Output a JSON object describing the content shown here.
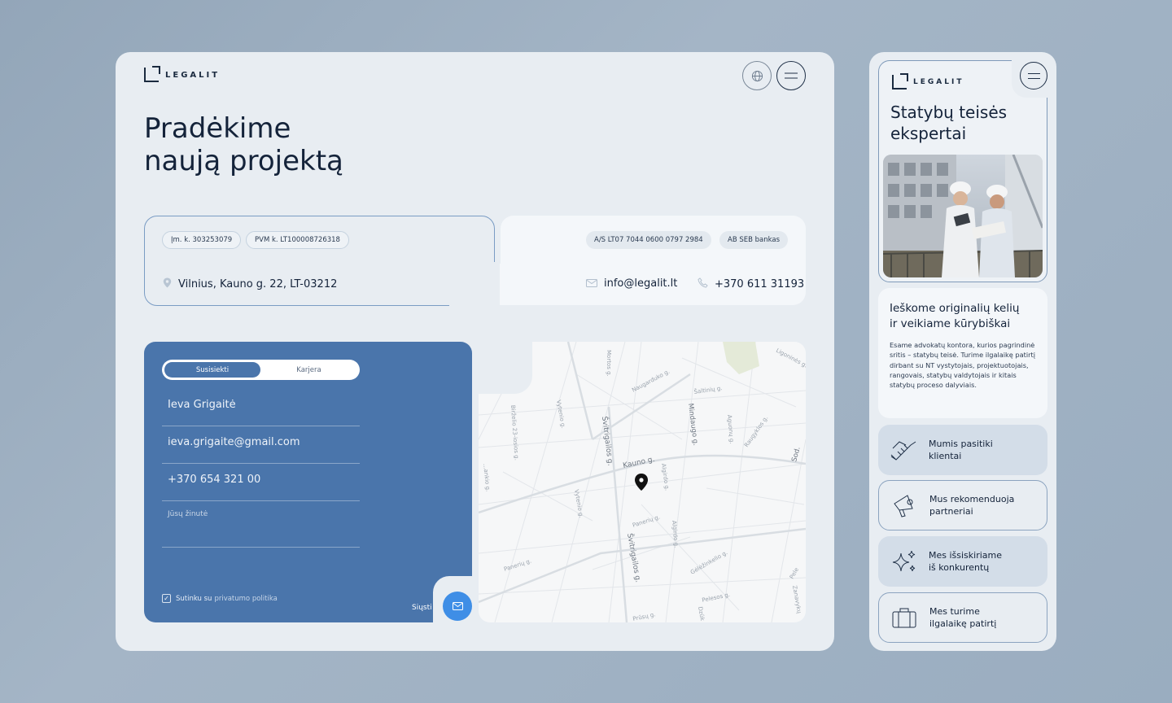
{
  "brand": {
    "name": "LEGALIT"
  },
  "desktop": {
    "heading_line1": "Pradėkime",
    "heading_line2": "naują projektą",
    "company": {
      "code": "Įm. k. 303253079",
      "vat": "PVM k. LT100008726318",
      "address": "Vilnius, Kauno g. 22, LT-03212",
      "account": "A/S LT07 7044 0600 0797 2984",
      "bank": "AB SEB bankas",
      "email": "info@legalit.lt",
      "phone": "+370 611 31193"
    },
    "form": {
      "tabs": [
        "Susisiekti",
        "Karjera"
      ],
      "name": "Ieva Grigaitė",
      "email": "ieva.grigaite@gmail.com",
      "phone": "+370 654 321 00",
      "message_placeholder": "Jūsų žinutė",
      "consent_prefix": "Sutinku su",
      "consent_link": "privatumo politika",
      "send_label": "Siųsti"
    },
    "map": {
      "streets": [
        "Mortos g.",
        "Naugarduko g.",
        "Šaltinių g.",
        "Ligoninės g.",
        "Birželio 23-iosios g.",
        "Vytenio g.",
        "Švitrigailos g.",
        "Mindaugo g.",
        "Algirdo g.",
        "Kauno g.",
        "Aguonų g.",
        "Raugyklos g.",
        "Sod.",
        "Vytenio g.",
        "Panerių g.",
        "Švitrigailos g.",
        "Algirdo g.",
        "Gėlėžinkelio g.",
        "Panerių g.",
        "Pelesos g.",
        "Pele",
        "Prūsų g.",
        "Dzūk",
        "Zanavykų",
        "...ankio g."
      ]
    }
  },
  "mobile": {
    "title_line1": "Statybų teisės",
    "title_line2": "ekspertai",
    "about_title_line1": "Ieškome originalių kelių",
    "about_title_line2": "ir veikiame kūrybiškai",
    "about_text": "Esame advokatų kontora, kurios pagrindinė sritis – statybų teisė. Turime ilgalaikę patirtį dirbant su NT vystytojais, projektuotojais, rangovais, statybų valdytojais ir kitais statybų proceso dalyviais.",
    "features": [
      {
        "line1": "Mumis pasitiki",
        "line2": "klientai",
        "icon": "handshake-icon"
      },
      {
        "line1": "Mus rekomenduoja",
        "line2": "partneriai",
        "icon": "megaphone-icon"
      },
      {
        "line1": "Mes išsiskiriame",
        "line2": "iš konkurentų",
        "icon": "sparkles-icon"
      },
      {
        "line1": "Mes turime",
        "line2": "ilgalaikę patirtį",
        "icon": "briefcase-icon"
      }
    ]
  },
  "colors": {
    "accent": "#4a75ab",
    "send": "#3f8ee6",
    "ink": "#14233a"
  }
}
